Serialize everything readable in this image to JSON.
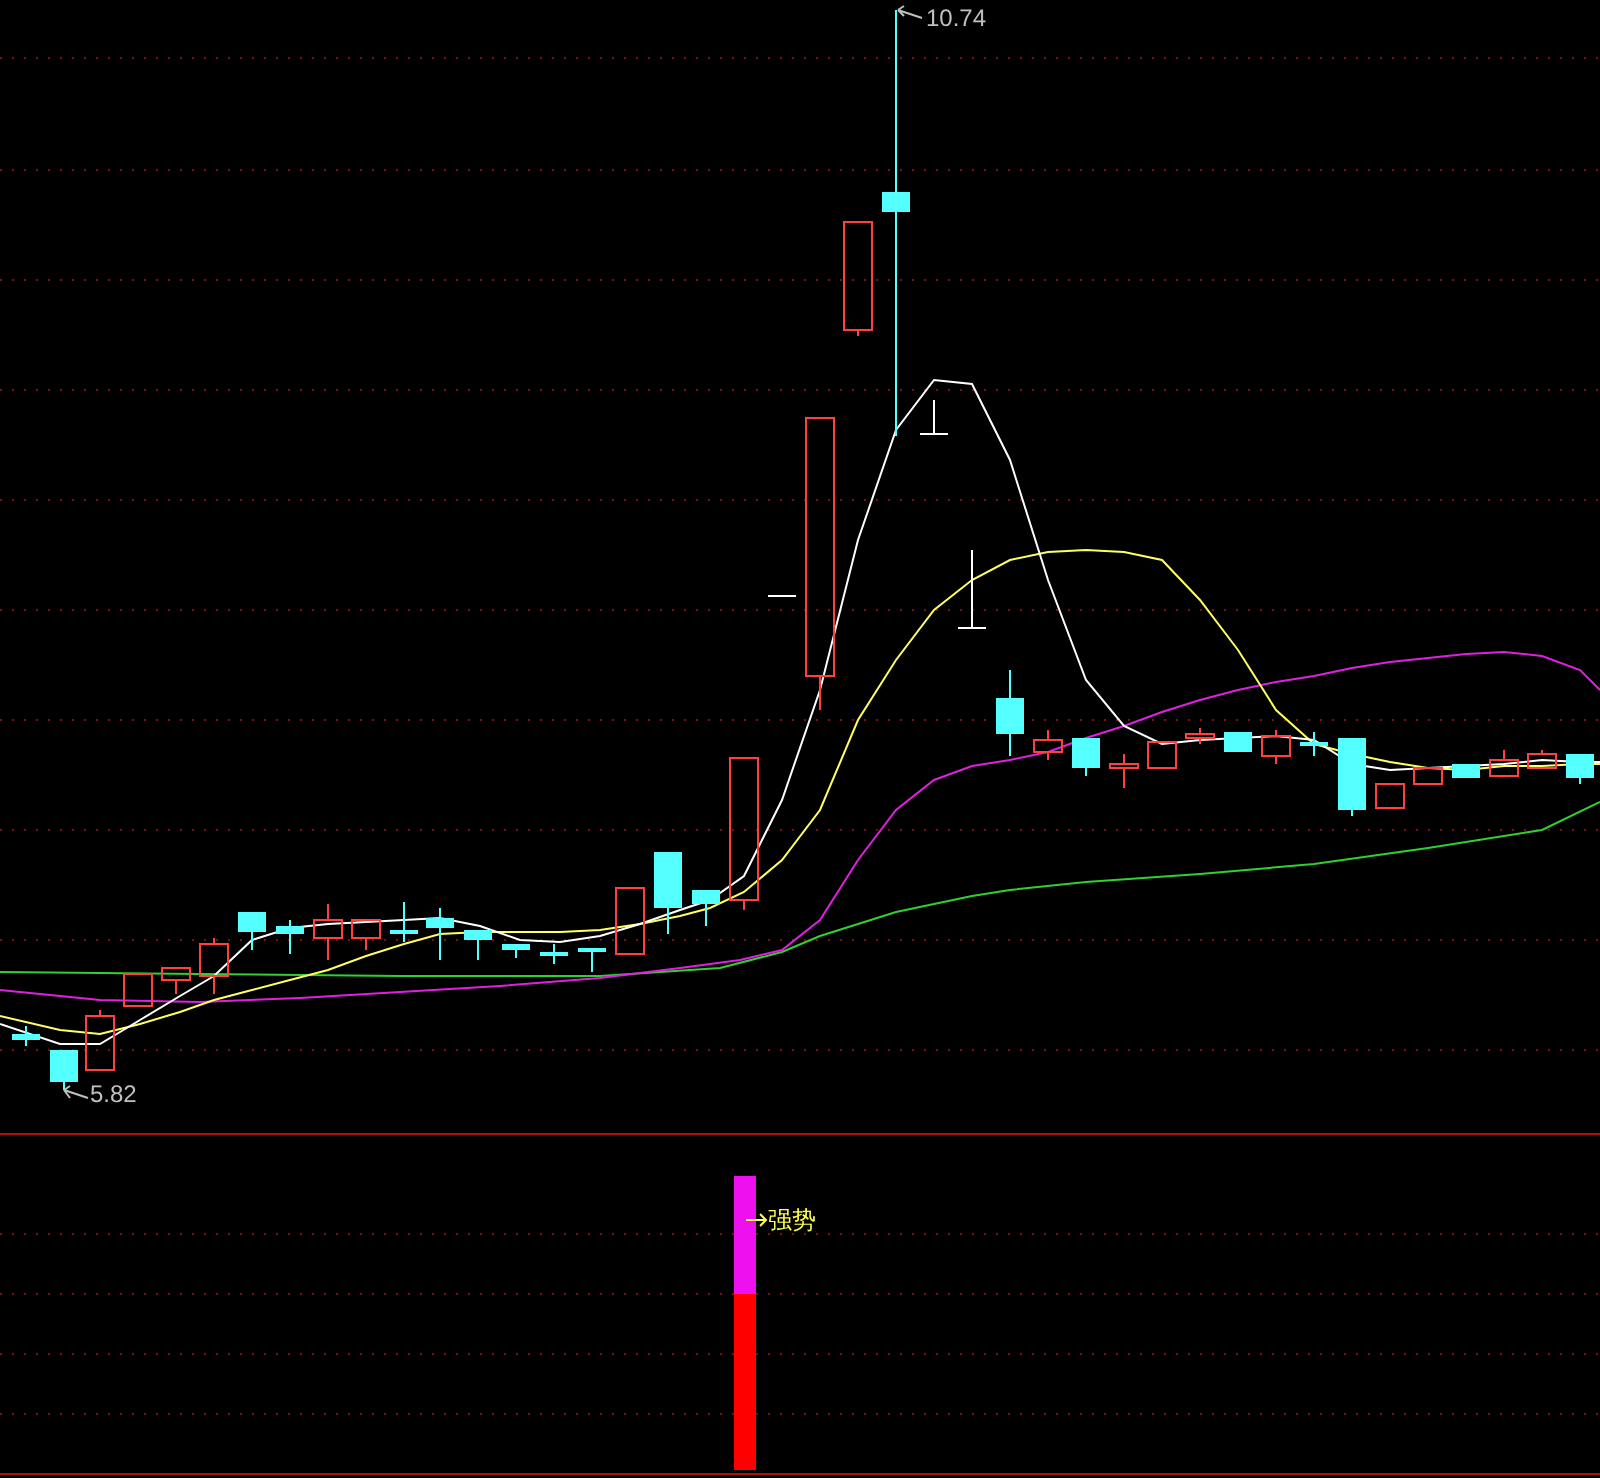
{
  "price_chart": {
    "high_label": "10.74",
    "low_label": "5.82"
  },
  "indicator_panel": {
    "signal_label": "强势"
  }
}
